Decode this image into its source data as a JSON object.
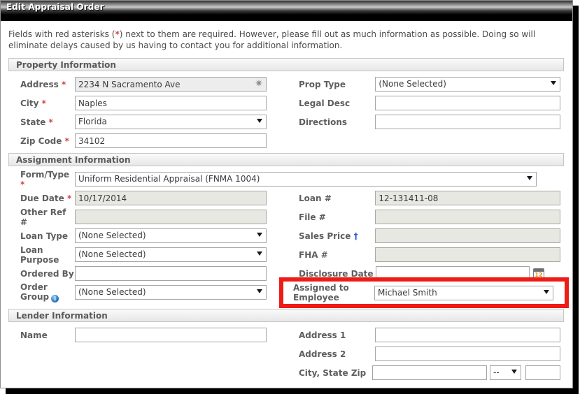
{
  "window": {
    "title": "Edit Appraisal Order"
  },
  "intro": {
    "prefix": "Fields with red asterisks (",
    "asterisk": "*",
    "suffix": ") next to them are required. However, please fill out as much information as possible. Doing so will eliminate delays caused by us having to contact you for additional information."
  },
  "sections": {
    "property": {
      "header": "Property Information",
      "fields": {
        "address_label": "Address",
        "address_value": "2234 N Sacramento Ave",
        "address_icon": "map-pin-icon",
        "city_label": "City",
        "city_value": "Naples",
        "state_label": "State",
        "state_value": "Florida",
        "zip_label": "Zip Code",
        "zip_value": "34102",
        "prop_type_label": "Prop Type",
        "prop_type_value": "(None Selected)",
        "legal_desc_label": "Legal Desc",
        "legal_desc_value": "",
        "directions_label": "Directions",
        "directions_value": ""
      }
    },
    "assignment": {
      "header": "Assignment Information",
      "fields": {
        "form_type_label": "Form/Type",
        "form_type_value": "Uniform Residential Appraisal (FNMA 1004)",
        "due_date_label": "Due Date",
        "due_date_value": "10/17/2014",
        "other_ref_label": "Other Ref #",
        "other_ref_value": "",
        "loan_type_label": "Loan Type",
        "loan_type_value": "(None Selected)",
        "loan_purpose_label": "Loan Purpose",
        "loan_purpose_value": "(None Selected)",
        "ordered_by_label": "Ordered By",
        "ordered_by_value": "",
        "order_group_label": "Order Group",
        "order_group_info": "i",
        "order_group_value": "(None Selected)",
        "loan_num_label": "Loan #",
        "loan_num_value": "12-131411-08",
        "file_num_label": "File #",
        "file_num_value": "",
        "sales_price_label": "Sales Price",
        "sales_price_dagger": "†",
        "sales_price_value": "",
        "fha_num_label": "FHA #",
        "fha_num_value": "",
        "disclosure_date_label": "Disclosure Date",
        "disclosure_date_value": "",
        "calendar_day": "12",
        "assigned_to_label_line1": "Assigned to",
        "assigned_to_label_line2": "Employee",
        "assigned_to_value": "Michael Smith"
      }
    },
    "lender": {
      "header": "Lender Information",
      "fields": {
        "name_label": "Name",
        "name_value": "",
        "address1_label": "Address 1",
        "address1_value": "",
        "address2_label": "Address 2",
        "address2_value": "",
        "city_state_zip_label": "City, State Zip",
        "city_value": "",
        "state_value": "--",
        "zip_value": ""
      }
    }
  },
  "colors": {
    "required_asterisk": "#d43f3f",
    "highlight_box": "#ee1b17",
    "info_icon": "#1a6fbf",
    "dagger": "#2d5fc4",
    "calendar_number": "#e8820c"
  }
}
